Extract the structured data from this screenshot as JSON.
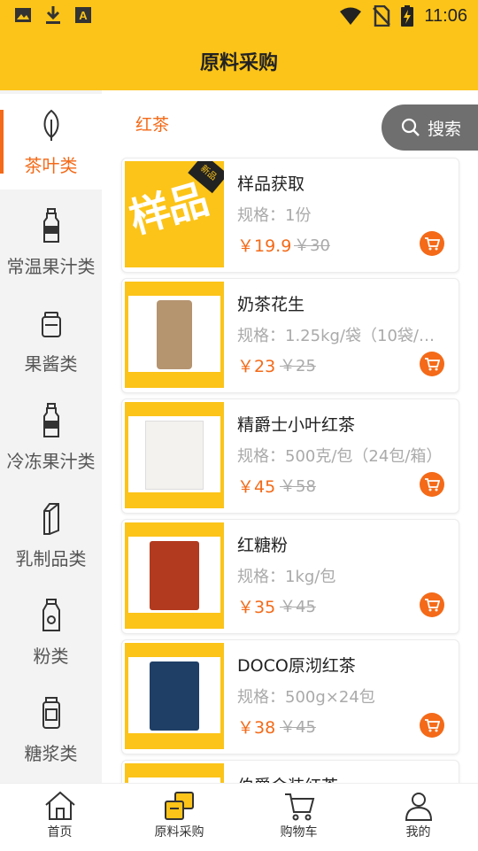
{
  "status_bar": {
    "time": "11:06",
    "left_icons": [
      "image-icon",
      "download-icon",
      "font-icon"
    ],
    "right_icons": [
      "wifi-icon",
      "no-sim-icon",
      "battery-charging-icon"
    ]
  },
  "header": {
    "title": "原料采购"
  },
  "sidebar": {
    "categories": [
      {
        "label": "茶叶类",
        "icon": "leaf-icon",
        "active": true
      },
      {
        "label": "常温果汁类",
        "icon": "bottle-icon",
        "active": false
      },
      {
        "label": "果酱类",
        "icon": "jar-icon",
        "active": false
      },
      {
        "label": "冷冻果汁类",
        "icon": "bottle-icon",
        "active": false
      },
      {
        "label": "乳制品类",
        "icon": "milk-carton-icon",
        "active": false
      },
      {
        "label": "粉类",
        "icon": "milk-carton-icon",
        "active": false
      },
      {
        "label": "糖浆类",
        "icon": "jar-icon",
        "active": false
      }
    ]
  },
  "main": {
    "section_title": "红茶",
    "search_label": "搜索",
    "products": [
      {
        "name": "样品获取",
        "spec": "规格：1份",
        "price": "￥19.9",
        "old_price": "￥30",
        "thumb": "sample"
      },
      {
        "name": "奶茶花生",
        "spec": "规格：1.25kg/袋（10袋/…",
        "price": "￥23",
        "old_price": "￥25",
        "thumb": "peanut"
      },
      {
        "name": "精爵士小叶红茶",
        "spec": "规格：500克/包（24包/箱）",
        "price": "￥45",
        "old_price": "￥58",
        "thumb": "tea-white"
      },
      {
        "name": "红糖粉",
        "spec": "规格：1kg/包",
        "price": "￥35",
        "old_price": "￥45",
        "thumb": "sugar"
      },
      {
        "name": "DOCO原沏红茶",
        "spec": "规格：500g×24包",
        "price": "￥38",
        "old_price": "￥45",
        "thumb": "tea-blue"
      },
      {
        "name": "伯爵金装红茶",
        "spec": "",
        "price": "",
        "old_price": "",
        "thumb": "tea-white"
      }
    ]
  },
  "tabbar": {
    "tabs": [
      {
        "label": "首页",
        "icon": "home-icon"
      },
      {
        "label": "原料采购",
        "icon": "purchase-icon"
      },
      {
        "label": "购物车",
        "icon": "cart-icon"
      },
      {
        "label": "我的",
        "icon": "user-icon"
      }
    ]
  },
  "colors": {
    "accent": "#f46a18",
    "brand_yellow": "#fcc419"
  }
}
